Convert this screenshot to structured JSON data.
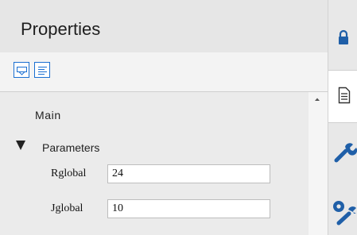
{
  "panel": {
    "title": "Properties",
    "toolbar": {
      "buttons": [
        {
          "icon": "categorized-view-icon"
        },
        {
          "icon": "alphabetical-list-icon"
        }
      ]
    },
    "sections": [
      {
        "label": "Main",
        "collapsed": true
      },
      {
        "label": "Parameters",
        "expanded": true
      }
    ],
    "properties": [
      {
        "label": "Rglobal",
        "value": "24"
      },
      {
        "label": "Jglobal",
        "value": "10"
      }
    ]
  },
  "side_tabs": [
    {
      "icon": "lock-icon",
      "active": false
    },
    {
      "icon": "document-icon",
      "active": true
    },
    {
      "icon": "wrench-icon",
      "active": false
    },
    {
      "icon": "gear-wrench-icon",
      "active": false
    }
  ],
  "colors": {
    "accent": "#1a6fd1",
    "icon_blue": "#1f5fa8",
    "panel_bg": "#f0f0f0",
    "header_bg": "#e6e6e6"
  }
}
